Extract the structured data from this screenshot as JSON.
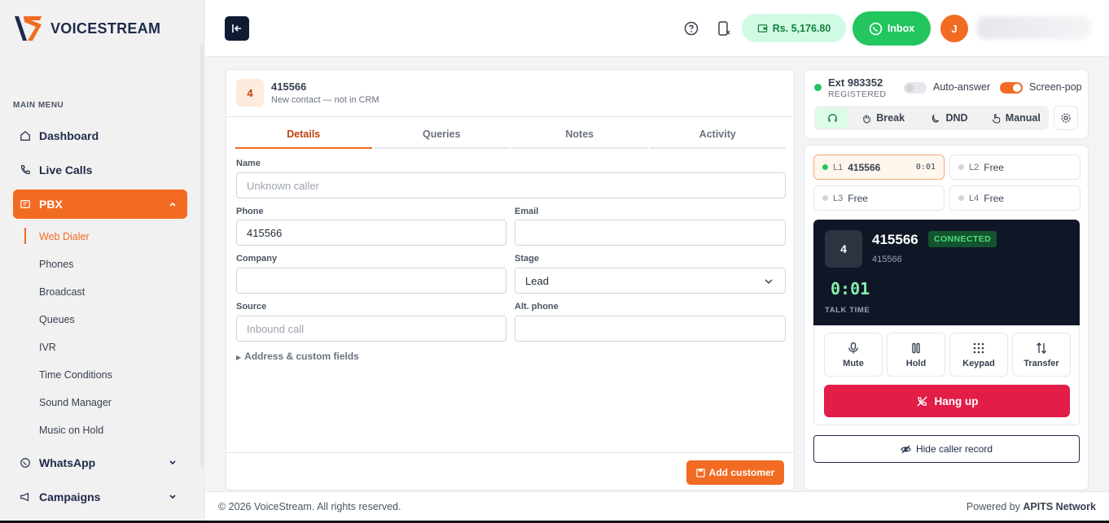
{
  "brand": {
    "name": "VOICESTREAM"
  },
  "sidebar": {
    "menu_title": "MAIN MENU",
    "items": [
      {
        "label": "Dashboard",
        "icon": "home-icon"
      },
      {
        "label": "Live Calls",
        "icon": "phone-icon"
      },
      {
        "label": "PBX",
        "icon": "pbx-icon",
        "expanded": true
      },
      {
        "label": "WhatsApp",
        "icon": "whatsapp-icon"
      },
      {
        "label": "Campaigns",
        "icon": "megaphone-icon"
      }
    ],
    "pbx_sub": [
      "Web Dialer",
      "Phones",
      "Broadcast",
      "Queues",
      "IVR",
      "Time Conditions",
      "Sound Manager",
      "Music on Hold"
    ]
  },
  "topbar": {
    "balance": "Rs. 5,176.80",
    "inbox_label": "Inbox",
    "avatar_initial": "J"
  },
  "caller": {
    "badge": "4",
    "number": "415566",
    "subtitle": "New contact — not in CRM"
  },
  "tabs": [
    "Details",
    "Queries",
    "Notes",
    "Activity"
  ],
  "form": {
    "name_label": "Name",
    "name_placeholder": "Unknown caller",
    "phone_label": "Phone",
    "phone_value": "415566",
    "email_label": "Email",
    "email_value": "",
    "company_label": "Company",
    "company_value": "",
    "stage_label": "Stage",
    "stage_value": "Lead",
    "source_label": "Source",
    "source_placeholder": "Inbound call",
    "alt_phone_label": "Alt. phone",
    "alt_phone_value": "",
    "address_toggle": "Address & custom fields",
    "add_customer_label": "Add customer"
  },
  "extension": {
    "ext": "Ext 983352",
    "status": "REGISTERED",
    "auto_answer_label": "Auto-answer",
    "auto_answer_on": false,
    "screen_pop_label": "Screen-pop",
    "screen_pop_on": true,
    "modes": [
      "Break",
      "DND",
      "Manual"
    ]
  },
  "lines": [
    {
      "id": "L1",
      "label": "415566",
      "timer": "0:01",
      "active": true
    },
    {
      "id": "L2",
      "label": "Free"
    },
    {
      "id": "L3",
      "label": "Free"
    },
    {
      "id": "L4",
      "label": "Free"
    }
  ],
  "call": {
    "badge": "4",
    "number": "415566",
    "status": "CONNECTED",
    "sub": "415566",
    "talk_time": "0:01",
    "talk_label": "TALK TIME",
    "controls": [
      "Mute",
      "Hold",
      "Keypad",
      "Transfer"
    ],
    "hangup_label": "Hang up",
    "hide_record_label": "Hide caller record"
  },
  "footer": {
    "copyright": "© 2026 VoiceStream. All rights reserved.",
    "powered_prefix": "Powered by ",
    "powered_brand": "APITS Network"
  },
  "colors": {
    "accent": "#f26b22",
    "navy": "#0f1b33",
    "success": "#22c55e",
    "danger": "#e11d48"
  }
}
